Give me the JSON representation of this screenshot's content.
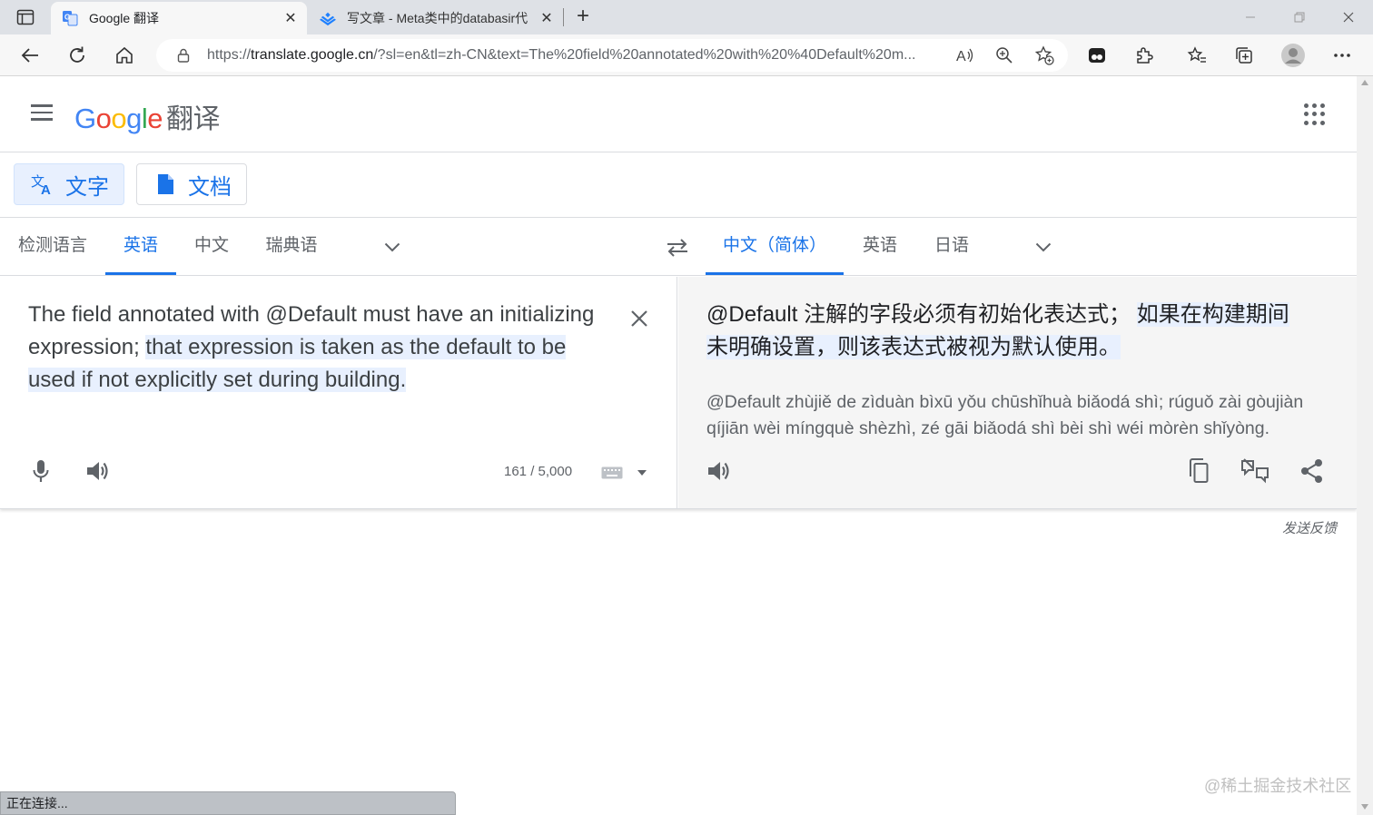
{
  "browser": {
    "tabs": [
      {
        "title": "Google 翻译",
        "active": true,
        "icon": "google-translate-favicon"
      },
      {
        "title": "写文章 - Meta类中的databasir代",
        "active": false,
        "icon": "juejin-favicon"
      }
    ],
    "address": {
      "prefix": "https://",
      "host": "translate.google.cn",
      "path": "/?sl=en&tl=zh-CN&text=The%20field%20annotated%20with%20%40Default%20m..."
    },
    "status_text": "正在连接..."
  },
  "header": {
    "logo_letters": [
      "G",
      "o",
      "o",
      "g",
      "l",
      "e"
    ],
    "product_name": "翻译"
  },
  "modes": {
    "text_label": "文字",
    "docs_label": "文档"
  },
  "source_langs": {
    "detect": "检测语言",
    "items": [
      "英语",
      "中文",
      "瑞典语"
    ],
    "selected": "英语"
  },
  "target_langs": {
    "items": [
      "中文（简体）",
      "英语",
      "日语"
    ],
    "selected": "中文（简体）"
  },
  "source": {
    "text_plain": "The field annotated with @Default must have an initializing expression; ",
    "text_highlight": "that expression is taken as the default to be used if not explicitly set during building.",
    "char_count": "161 / 5,000"
  },
  "target": {
    "text_plain": "@Default 注解的字段必须有初始化表达式； ",
    "text_highlight": "如果在构建期间未明确设置，则该表达式被视为默认使用。",
    "transliteration": "@Default zhùjiě de zìduàn bìxū yǒu chūshǐhuà biǎodá shì; rúguǒ zài gòujiàn qíjiān wèi míngquè shèzhì, zé gāi biǎodá shì bèi shì wéi mòrèn shǐyòng."
  },
  "feedback_label": "发送反馈",
  "watermark": "@稀土掘金技术社区",
  "colors": {
    "accent": "#1a73e8",
    "highlight": "#e8f0fe",
    "logo": [
      "#4285f4",
      "#ea4335",
      "#fbbc05",
      "#4285f4",
      "#34a853",
      "#ea4335"
    ]
  }
}
